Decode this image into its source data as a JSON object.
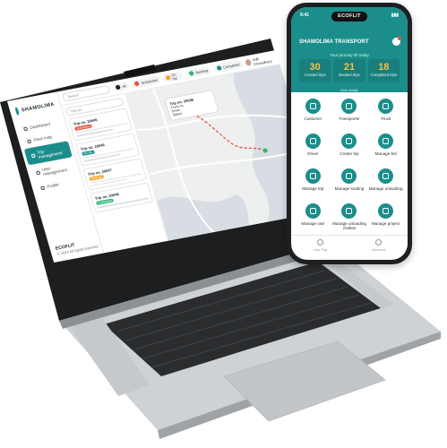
{
  "web": {
    "logo": "SHAMOLIMA",
    "search_placeholder": "Search",
    "nav": [
      {
        "label": "Dashboard",
        "active": false
      },
      {
        "label": "Fleet map",
        "active": false
      },
      {
        "label": "Trip management",
        "active": true
      },
      {
        "label": "User management",
        "active": false
      },
      {
        "label": "Profile",
        "active": false
      }
    ],
    "filters": [
      {
        "label": "All",
        "color": "#1b2328"
      },
      {
        "label": "Scheduled",
        "color": "#e9513f"
      },
      {
        "label": "On trip",
        "color": "#f5a524"
      },
      {
        "label": "Booking",
        "color": "#2bb673"
      },
      {
        "label": "Completed",
        "color": "#1b8e8b"
      }
    ],
    "user_name": "Adil Chowdhury",
    "trips_search": "Trip no",
    "trips": [
      {
        "title": "Trip no. 20045",
        "badge": "Scheduled",
        "badge_color": "#e9513f"
      },
      {
        "title": "Trip no. 20046",
        "badge": "On trip",
        "badge_color": "#1b8e8b"
      },
      {
        "title": "Trip no. 20047",
        "badge": "Booking",
        "badge_color": "#f5a524"
      },
      {
        "title": "Trip no. 20048",
        "badge": "Completed",
        "badge_color": "#2bb673"
      }
    ],
    "map_popup": {
      "title": "Trip no. 20046",
      "lines": [
        "Truck no.",
        "Driver",
        "Status"
      ]
    },
    "brand_footer": "ECOFLIT",
    "brand_footer_sub": "© 2024 All rights reserved"
  },
  "phone": {
    "time": "9:41",
    "island_text": "ECOFLIT",
    "title": "SHAMOLIMA TRANSPORT",
    "subtitle": "Your journey till today",
    "stats": [
      {
        "value": "30",
        "label": "Created trips"
      },
      {
        "value": "21",
        "label": "Booked trips"
      },
      {
        "value": "18",
        "label": "Completed trips"
      }
    ],
    "view_details": "View details",
    "tiles": [
      "Customer",
      "Transporter",
      "Truck",
      "Driver",
      "Create trip",
      "Manage bid",
      "Manage trip",
      "Manage loading",
      "Manage unloading",
      "Manage rate",
      "Manage unloading challan",
      "Manage project"
    ],
    "tabs": [
      "Live Trip",
      "Account"
    ]
  },
  "colors": {
    "brand": "#1b8e8b",
    "accent": "#f7c04a"
  }
}
